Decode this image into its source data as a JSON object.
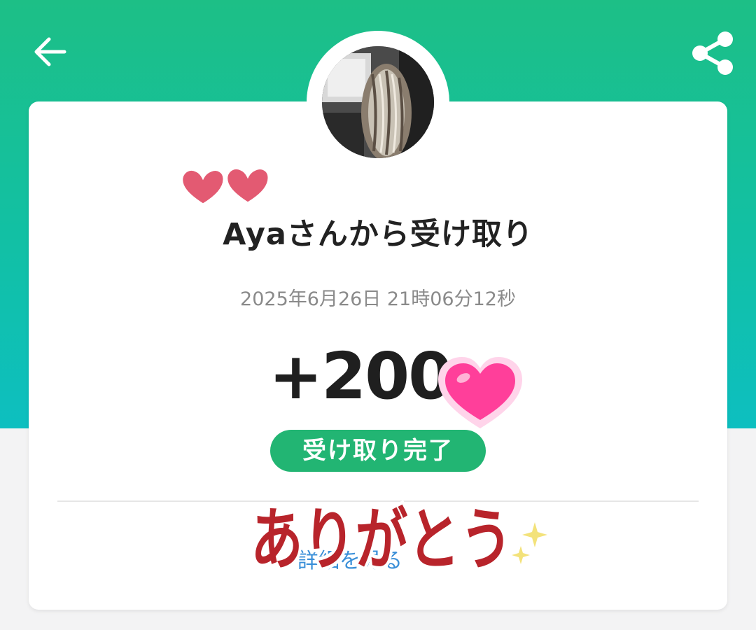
{
  "header": {
    "back_icon": "arrow-left-icon",
    "share_icon": "share-icon",
    "gradient_colors": [
      "#1dbf86",
      "#0dbfc0"
    ]
  },
  "sender": {
    "avatar_description": "profile photo",
    "title": "Ayaさんから受け取り"
  },
  "transaction": {
    "timestamp": "2025年6月26日 21時06分12秒",
    "amount": "+200",
    "status": "受け取り完了",
    "status_color": "#22b573"
  },
  "footer": {
    "details_link": "詳細を見る"
  },
  "stickers": {
    "thank_you_text": "ありがとう",
    "thank_you_color": "#b8242b",
    "heart_color": "#e35a72",
    "pink_heart_color": "#ff3f9a",
    "sparkle_color": "#f3e27a"
  }
}
